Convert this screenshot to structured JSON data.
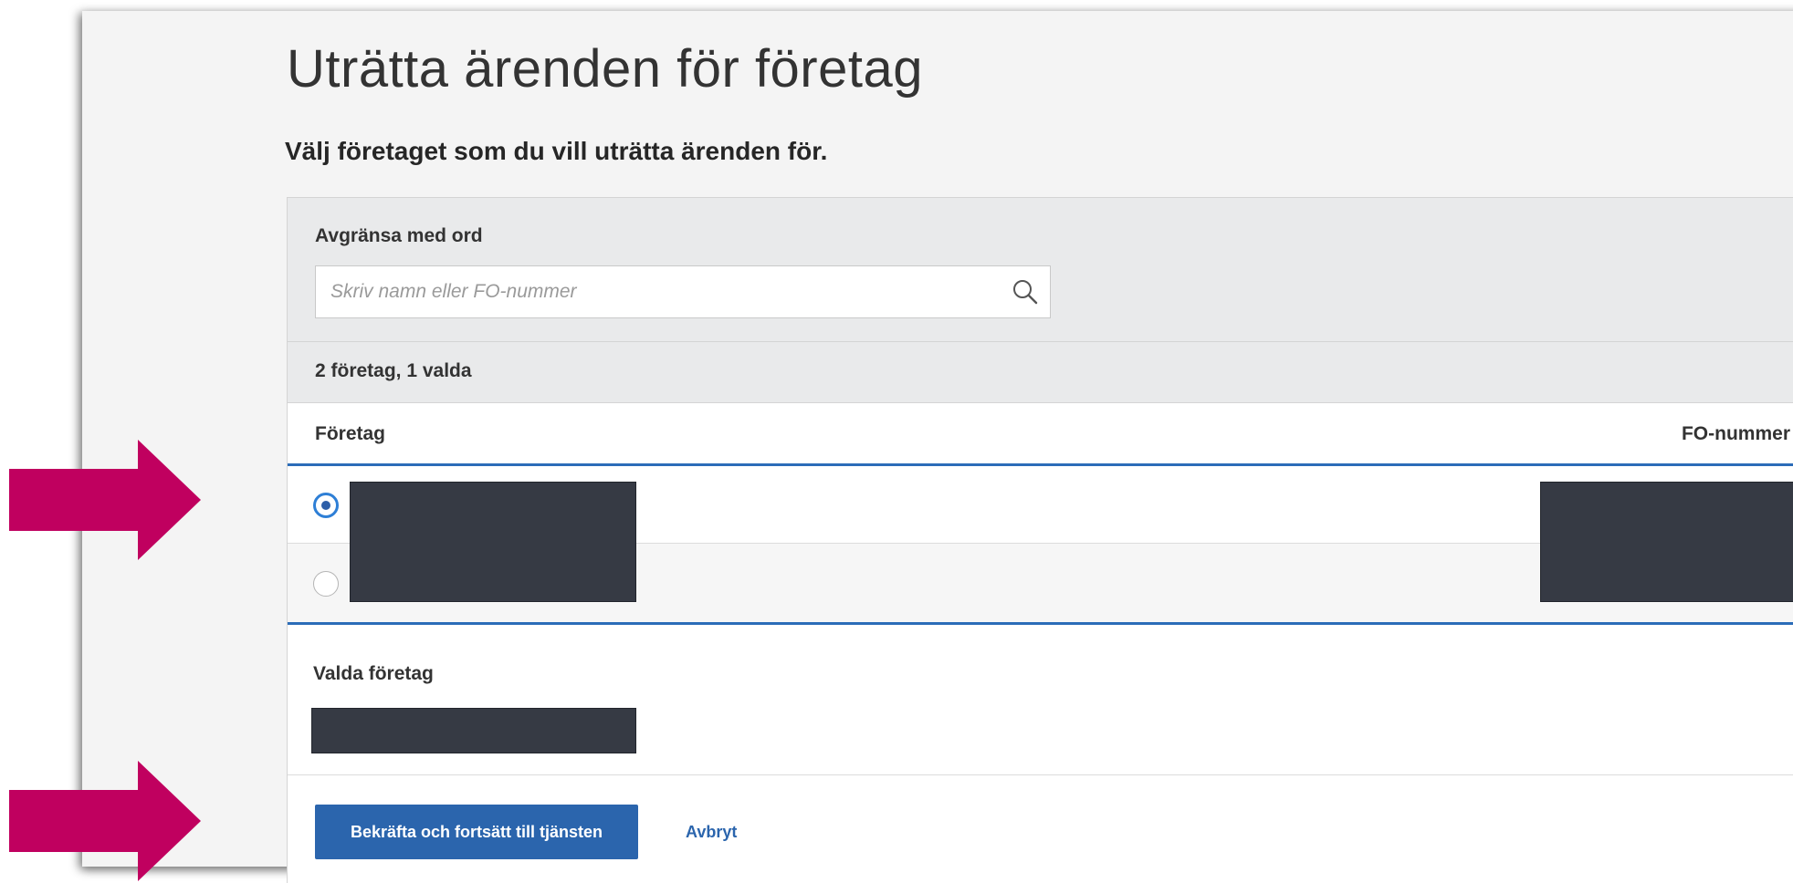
{
  "page": {
    "title": "Uträtta ärenden för företag",
    "subtitle": "Välj företaget som du vill uträtta ärenden för."
  },
  "filter": {
    "label": "Avgränsa med ord",
    "placeholder": "Skriv namn eller FO-nummer",
    "value": ""
  },
  "list": {
    "summary": "2 företag, 1 valda",
    "columns": {
      "company": "Företag",
      "fo_number": "FO-nummer"
    },
    "rows": [
      {
        "selected": true
      },
      {
        "selected": false
      }
    ]
  },
  "selection": {
    "label": "Valda företag"
  },
  "actions": {
    "confirm_label": "Bekräfta och fortsätt till tjänsten",
    "cancel_label": "Avbryt"
  },
  "colors": {
    "primary": "#2b65ad",
    "accent_line": "#2b6cb8",
    "annotation_arrow": "#c0005f",
    "redaction": "#363a44"
  },
  "icons": {
    "search": "search-icon",
    "annotation": "arrow-right-icon"
  }
}
